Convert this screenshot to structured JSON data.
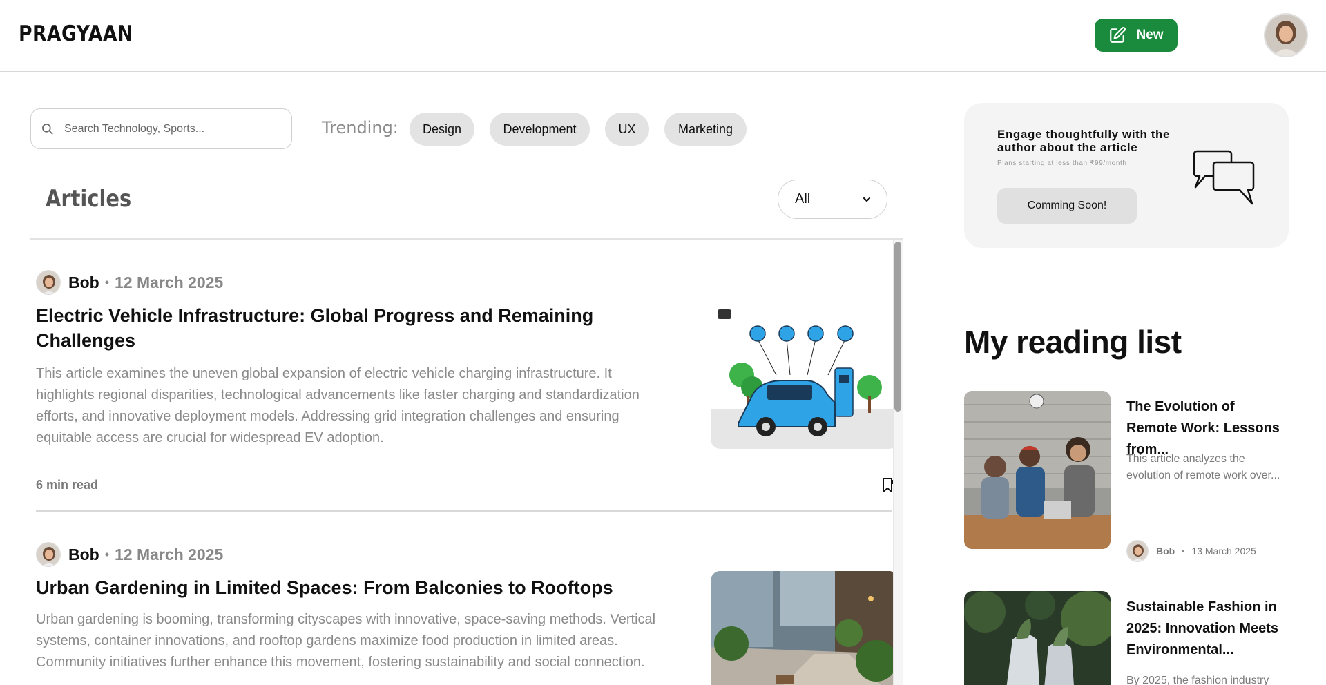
{
  "brand": {
    "logo": "PRAGYAAN"
  },
  "header": {
    "new_label": "New"
  },
  "search": {
    "placeholder": "Search Technology, Sports..."
  },
  "trending": {
    "label": "Trending:",
    "chips": [
      "Design",
      "Development",
      "UX",
      "Marketing"
    ]
  },
  "articles": {
    "heading": "Articles",
    "filter_value": "All",
    "items": [
      {
        "author": "Bob",
        "separator": "•",
        "date": "12 March 2025",
        "title": "Electric Vehicle Infrastructure: Global Progress and Remaining Challenges",
        "excerpt": "This article examines the uneven global expansion of electric vehicle charging infrastructure. It highlights regional disparities, technological advancements like faster charging and standardization efforts, and innovative deployment models. Addressing grid integration challenges and ensuring equitable access are crucial for widespread EV adoption.",
        "read_time": "6 min read"
      },
      {
        "author": "Bob",
        "separator": "•",
        "date": "12 March 2025",
        "title": "Urban Gardening in Limited Spaces: From Balconies to Rooftops",
        "excerpt": "Urban gardening is booming, transforming cityscapes with innovative, space-saving methods. Vertical systems, container innovations, and rooftop gardens maximize food production in limited areas. Community initiatives further enhance this movement, fostering sustainability and social connection."
      }
    ]
  },
  "promo": {
    "title": "Engage thoughtfully with the author about the article",
    "subtitle": "Plans starting at less than ₹99/month",
    "button": "Comming Soon!"
  },
  "reading_list": {
    "heading": "My reading list",
    "items": [
      {
        "title": "The Evolution of Remote Work: Lessons from...",
        "excerpt": "This article analyzes the evolution of remote work over...",
        "author": "Bob",
        "separator": "•",
        "date": "13 March 2025"
      },
      {
        "title": "Sustainable Fashion in 2025: Innovation Meets Environmental...",
        "excerpt": "By 2025, the fashion industry"
      }
    ]
  },
  "colors": {
    "accent": "#1a8a3c",
    "ev_blue": "#2ea3e6"
  }
}
